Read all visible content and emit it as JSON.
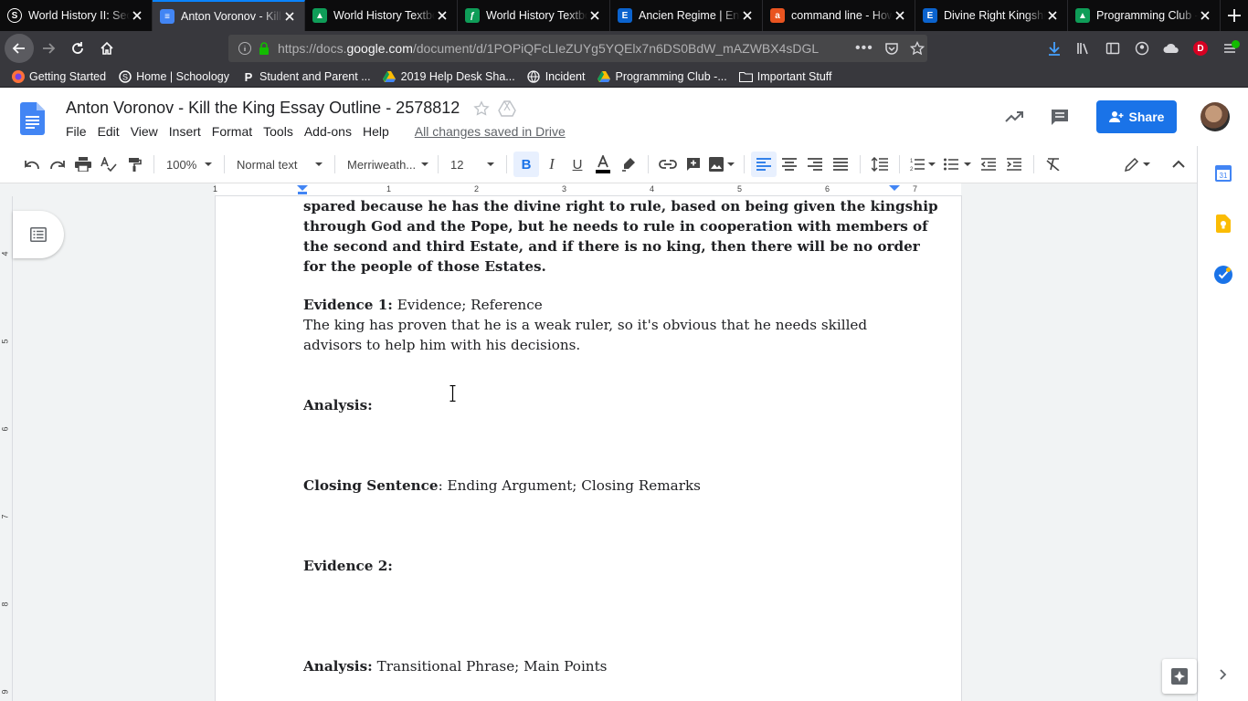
{
  "browser": {
    "tabs": [
      {
        "title": "World History II: Sec",
        "favicon": "schoology-icon",
        "color": "#1f73b7"
      },
      {
        "title": "Anton Voronov - Kill",
        "favicon": "docs-icon",
        "color": "#4285f4",
        "active": true
      },
      {
        "title": "World History Textbo",
        "favicon": "drive-icon",
        "color": "#0f9d58"
      },
      {
        "title": "World History Textbo",
        "favicon": "doc-icon",
        "color": "#0f9d58"
      },
      {
        "title": "Ancien Regime | Enc",
        "favicon": "britannica-icon",
        "color": "#0b63ce"
      },
      {
        "title": "command line - How",
        "favicon": "ask-icon",
        "color": "#e95420"
      },
      {
        "title": "Divine Right Kingshi",
        "favicon": "britannica-icon",
        "color": "#0b63ce"
      },
      {
        "title": "Programming Club -",
        "favicon": "drive-icon",
        "color": "#0f9d58"
      }
    ],
    "url_prefix": "https://docs.",
    "url_host": "google.com",
    "url_path": "/document/d/1POPiQFcLIeZUYg5YQElx7n6DS0BdW_mAZWBX4sDGL",
    "bookmarks": [
      {
        "label": "Getting Started",
        "icon": "firefox-icon"
      },
      {
        "label": "Home | Schoology",
        "icon": "schoology-icon"
      },
      {
        "label": "Student and Parent ...",
        "icon": "p-icon"
      },
      {
        "label": "2019 Help Desk Sha...",
        "icon": "drive-icon"
      },
      {
        "label": "Incident",
        "icon": "globe-icon"
      },
      {
        "label": "Programming Club -...",
        "icon": "drive-icon"
      },
      {
        "label": "Important Stuff",
        "icon": "folder-icon"
      }
    ],
    "profile_initial": "D"
  },
  "docs": {
    "title": "Anton Voronov - Kill the King Essay Outline - 2578812",
    "menus": [
      "File",
      "Edit",
      "View",
      "Insert",
      "Format",
      "Tools",
      "Add-ons",
      "Help"
    ],
    "saved_status": "All changes saved in Drive",
    "share_label": "Share",
    "toolbar": {
      "zoom": "100%",
      "style": "Normal text",
      "font": "Merriweath...",
      "size": "12"
    },
    "ruler_numbers": [
      "1",
      "1",
      "2",
      "3",
      "4",
      "5",
      "6",
      "7"
    ],
    "left_ruler_numbers": [
      "4",
      "5",
      "6",
      "7",
      "8",
      "9"
    ]
  },
  "document": {
    "p1_lines": [
      "spared because  he has the divine right to rule, based on being given the kingship",
      "through God and the Pope, but he needs to rule in cooperation with members of",
      "the second and third Estate, and if there is no king, then there will be no order",
      "for the people of those Estates."
    ],
    "evidence1_label": "Evidence 1:",
    "evidence1_text": " Evidence; Reference",
    "evidence1_body": [
      "The king has proven that he is a weak ruler, so it's obvious that he needs skilled",
      "advisors to help him with his decisions."
    ],
    "analysis1_label": "Analysis:",
    "closing_label": "Closing Sentence",
    "closing_text": ": Ending Argument; Closing Remarks",
    "evidence2_label": "Evidence 2:",
    "analysis2_label": "Analysis:",
    "analysis2_text": " Transitional Phrase; Main Points"
  },
  "colors": {
    "accent": "#1a73e8",
    "tab_active_indicator": "#0a84ff"
  }
}
